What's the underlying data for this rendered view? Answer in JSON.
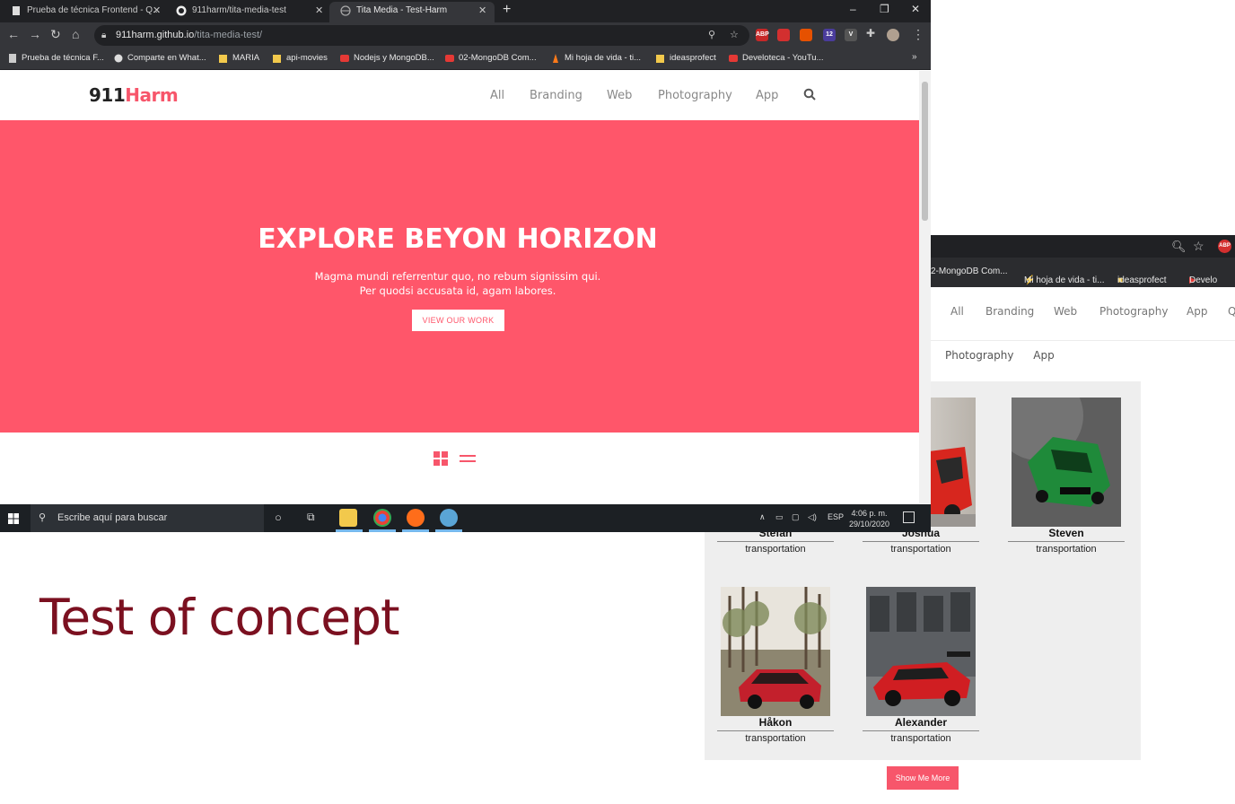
{
  "main_browser": {
    "tabs": [
      {
        "title": "Prueba de técnica Frontend - Q...",
        "active": false
      },
      {
        "title": "911harm/tita-media-test",
        "active": false
      },
      {
        "title": "Tita Media - Test-Harm",
        "active": true
      }
    ],
    "new_tab": "+",
    "window_controls": {
      "minimize": "–",
      "maximize": "❐",
      "close": "✕"
    },
    "address": {
      "host": "911harm.github.io",
      "path": "/tita-media-test/"
    },
    "extensions": [
      {
        "label": "ABP",
        "color": "#c62828"
      },
      {
        "label": "",
        "color": "#d32f2f"
      },
      {
        "label": "",
        "color": "#e65100"
      },
      {
        "label": "12",
        "color": "#4a3c9c"
      },
      {
        "label": "V",
        "color": "#555555"
      }
    ],
    "bookmarks": [
      "Prueba de técnica F...",
      "Comparte en What...",
      "MARIA",
      "api-movies",
      "Nodejs y MongoDB...",
      "02-MongoDB Com...",
      "Mi hoja de vida - ti...",
      "ideasprofect",
      "Develoteca - YouTu..."
    ],
    "bookmarks_more": "»"
  },
  "site": {
    "logo_a": "911",
    "logo_b": "Harm",
    "nav": [
      "All",
      "Branding",
      "Web",
      "Photography",
      "App"
    ],
    "hero_title": "EXPLORE BEYON HORIZON",
    "hero_line1": "Magma mundi referrentur quo, no rebum signissim qui.",
    "hero_line2": "Per quodsi accusata id, agam labores.",
    "hero_cta": "VIEW OUR WORK",
    "accent": "#ff566a"
  },
  "taskbar": {
    "search_placeholder": "Escribe aquí para buscar",
    "language": "ESP",
    "time": "4:06 p. m.",
    "date": "29/10/2020"
  },
  "background_browser": {
    "bookmarks": [
      "2-MongoDB Com...",
      "Mi hoja de vida - ti...",
      "ideasprofect",
      "Develo"
    ],
    "nav": [
      "All",
      "Branding",
      "Web",
      "Photography",
      "App"
    ],
    "subnav": [
      "Photography",
      "App"
    ],
    "gallery": [
      {
        "name": "Stefan",
        "category": "transportation"
      },
      {
        "name": "Joshua",
        "category": "transportation"
      },
      {
        "name": "Steven",
        "category": "transportation"
      },
      {
        "name": "Håkon",
        "category": "transportation"
      },
      {
        "name": "Alexander",
        "category": "transportation"
      }
    ],
    "show_more": "Show Me More"
  },
  "slide_title": "Test of concept"
}
